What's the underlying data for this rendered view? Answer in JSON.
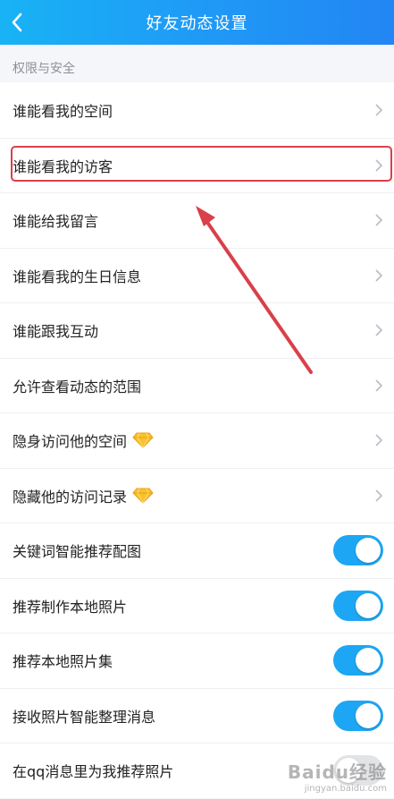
{
  "header": {
    "title": "好友动态设置",
    "bg_color": "#1f9af6"
  },
  "section": {
    "label": "权限与安全"
  },
  "rows": [
    {
      "label": "谁能看我的空间",
      "control": "chevron"
    },
    {
      "label": "谁能看我的访客",
      "control": "chevron",
      "highlighted": true
    },
    {
      "label": "谁能给我留言",
      "control": "chevron"
    },
    {
      "label": "谁能看我的生日信息",
      "control": "chevron"
    },
    {
      "label": "谁能跟我互动",
      "control": "chevron"
    },
    {
      "label": "允许查看动态的范围",
      "control": "chevron"
    },
    {
      "label": "隐身访问他的空间",
      "control": "chevron",
      "badge": "diamond-icon"
    },
    {
      "label": "隐藏他的访问记录",
      "control": "chevron",
      "badge": "diamond-icon"
    },
    {
      "label": "关键词智能推荐配图",
      "control": "toggle",
      "on": true
    },
    {
      "label": "推荐制作本地照片",
      "control": "toggle",
      "on": true
    },
    {
      "label": "推荐本地照片集",
      "control": "toggle",
      "on": true
    },
    {
      "label": "接收照片智能整理消息",
      "control": "toggle",
      "on": true
    },
    {
      "label": "在qq消息里为我推荐照片",
      "control": "toggle",
      "on": false
    }
  ],
  "annotation": {
    "color": "#d9404a",
    "points_to": "谁能看我的访客"
  },
  "watermark": {
    "main": "Baidu经验",
    "sub": "jingyan.baidu.com"
  },
  "colors": {
    "toggle_on": "#1da6f3",
    "toggle_off": "#e2e3e6",
    "chevron": "#b8bcc4"
  }
}
